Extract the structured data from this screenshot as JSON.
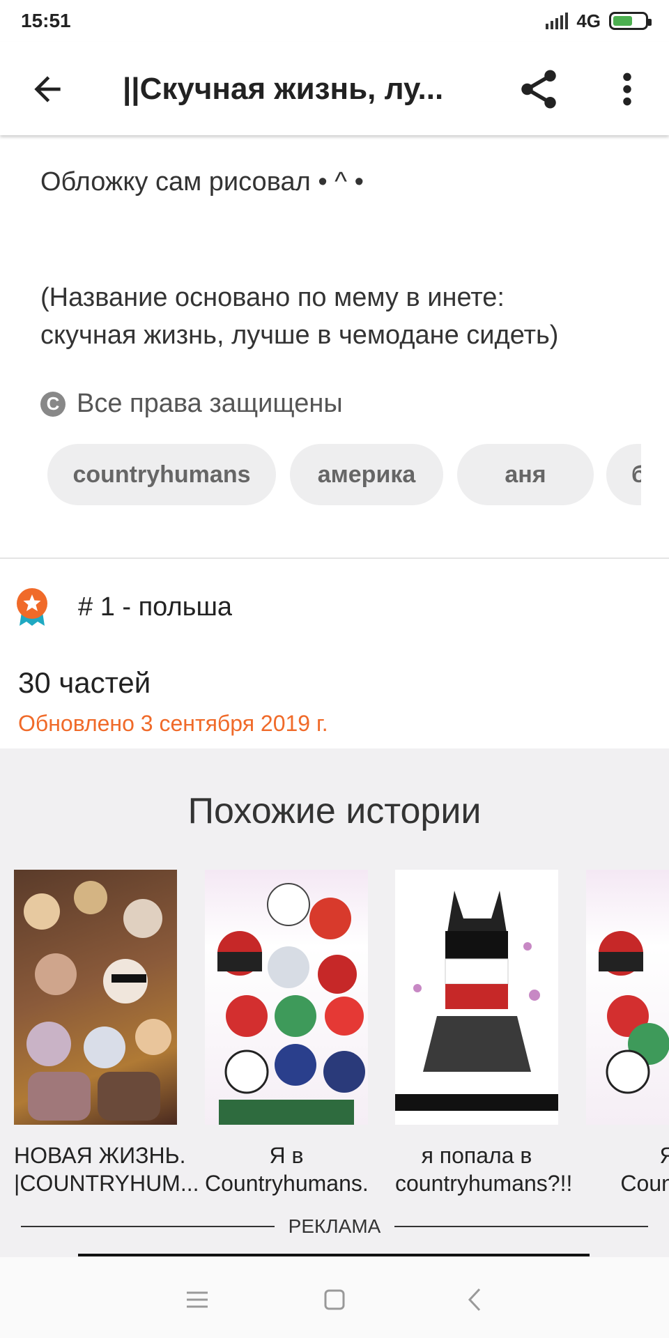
{
  "status": {
    "time": "15:51",
    "network": "4G"
  },
  "toolbar": {
    "title": "||Скучная жизнь, лу..."
  },
  "description": {
    "line1": "Обложку сам рисовал • ^ •",
    "line2": "(Название основано по мему в инете:",
    "line3": "скучная жизнь, лучше в чемодане сидеть)"
  },
  "copyright": {
    "label": "Все права защищены"
  },
  "tags": [
    "countryhumans",
    "америка",
    "аня",
    "б"
  ],
  "ranking": {
    "text": "# 1 - польша"
  },
  "story": {
    "parts": "30 частей",
    "updated": "Обновлено 3 сентября 2019 г."
  },
  "similar": {
    "heading": "Похожие истории",
    "items": [
      {
        "title_line1": "НОВАЯ ЖИЗНЬ.",
        "title_line2": "|COUNTRYHUM..."
      },
      {
        "title_line1": "Я в",
        "title_line2": "Countryhumans."
      },
      {
        "title_line1": "я попала в",
        "title_line2": "countryhumans?!!"
      },
      {
        "title_line1": "Я",
        "title_line2": "CountryH"
      }
    ]
  },
  "ad": {
    "label": "РЕКЛАМА"
  },
  "icons": {
    "back": "arrow-left-icon",
    "share": "share-icon",
    "more": "more-vert-icon",
    "copyright": "copyright-icon",
    "rank": "ribbon-badge-icon",
    "nav_menu": "menu-icon",
    "nav_home": "square-home-icon",
    "nav_back": "chevron-left-icon"
  },
  "colors": {
    "accent": "#f06a29",
    "badge_ribbon": "#1fa9c2",
    "similar_bg": "#f1f0f2",
    "tag_bg": "#eeeeef"
  }
}
